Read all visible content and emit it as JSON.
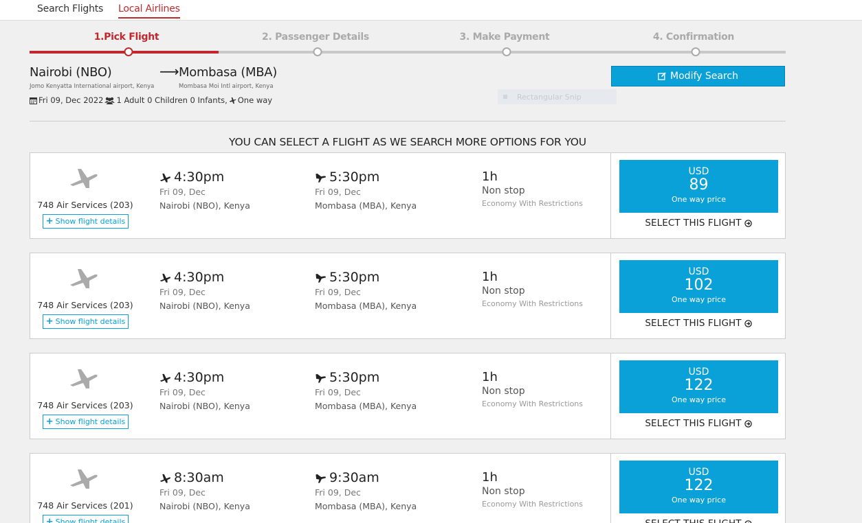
{
  "tabs": [
    "Search Flights",
    "Local Airlines"
  ],
  "steps": [
    "1.Pick Flight",
    "2. Passenger Details",
    "3. Make Payment",
    "4. Confirmation"
  ],
  "route": {
    "origin": "Nairobi (NBO)",
    "origin_airport": "Jomo Kenyatta International airport, Kenya",
    "destination": "Mombasa (MBA)",
    "destination_airport": "Mombasa Moi Intl airport, Kenya",
    "date": "Fri 09, Dec 2022",
    "passengers": "1 Adult 0 Children 0 Infants,",
    "trip_type": "One way"
  },
  "modify_label": "Modify Search",
  "snip_text": "Rectangular Snip",
  "headline": "YOU CAN SELECT A FLIGHT AS WE SEARCH MORE OPTIONS FOR YOU",
  "flights": [
    {
      "airline": "748 Air Services (203)",
      "details": "Show flight details",
      "dep_time": "4:30pm",
      "dep_date": "Fri 09, Dec",
      "dep_place": "Nairobi (NBO), Kenya",
      "arr_time": "5:30pm",
      "arr_date": "Fri 09, Dec",
      "arr_place": "Mombasa (MBA), Kenya",
      "duration": "1h",
      "stops": "Non stop",
      "cabin": "Economy With Restrictions",
      "currency": "USD",
      "price": "89",
      "price_note": "One way price",
      "select": "SELECT THIS FLIGHT"
    },
    {
      "airline": "748 Air Services (203)",
      "details": "Show flight details",
      "dep_time": "4:30pm",
      "dep_date": "Fri 09, Dec",
      "dep_place": "Nairobi (NBO), Kenya",
      "arr_time": "5:30pm",
      "arr_date": "Fri 09, Dec",
      "arr_place": "Mombasa (MBA), Kenya",
      "duration": "1h",
      "stops": "Non stop",
      "cabin": "Economy With Restrictions",
      "currency": "USD",
      "price": "102",
      "price_note": "One way price",
      "select": "SELECT THIS FLIGHT"
    },
    {
      "airline": "748 Air Services (203)",
      "details": "Show flight details",
      "dep_time": "4:30pm",
      "dep_date": "Fri 09, Dec",
      "dep_place": "Nairobi (NBO), Kenya",
      "arr_time": "5:30pm",
      "arr_date": "Fri 09, Dec",
      "arr_place": "Mombasa (MBA), Kenya",
      "duration": "1h",
      "stops": "Non stop",
      "cabin": "Economy With Restrictions",
      "currency": "USD",
      "price": "122",
      "price_note": "One way price",
      "select": "SELECT THIS FLIGHT"
    },
    {
      "airline": "748 Air Services (201)",
      "details": "Show flight details",
      "dep_time": "8:30am",
      "dep_date": "Fri 09, Dec",
      "dep_place": "Nairobi (NBO), Kenya",
      "arr_time": "9:30am",
      "arr_date": "Fri 09, Dec",
      "arr_place": "Mombasa (MBA), Kenya",
      "duration": "1h",
      "stops": "Non stop",
      "cabin": "Economy With Restrictions",
      "currency": "USD",
      "price": "122",
      "price_note": "One way price",
      "select": "SELECT THIS FLIGHT"
    }
  ],
  "colors": {
    "brand_red": "#c0282d",
    "accent_blue": "#0aa0d8"
  }
}
